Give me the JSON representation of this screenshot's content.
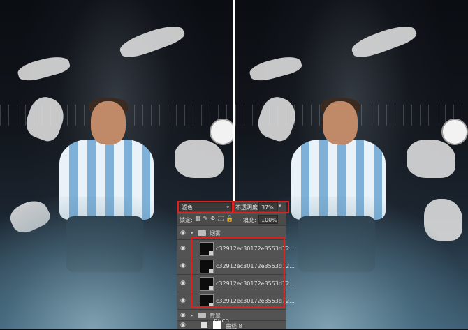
{
  "panel": {
    "blend_mode": "滤色",
    "opacity_label": "不透明度:",
    "opacity_value": "37%",
    "lock_label": "锁定:",
    "fill_label": "填充:",
    "fill_value": "100%",
    "group_name": "烟雾",
    "layers": [
      {
        "name": "c32912ec30172e3553d72..."
      },
      {
        "name": "c32912ec30172e3553d72..."
      },
      {
        "name": "c32912ec30172e3553d72..."
      },
      {
        "name": "c32912ec30172e3553d72..."
      }
    ],
    "group2_name": "背景",
    "curve_name": "曲线 8"
  },
  "watermark": "ni-cn",
  "colors": {
    "highlight": "#e0201e",
    "panel_bg": "#535353"
  }
}
